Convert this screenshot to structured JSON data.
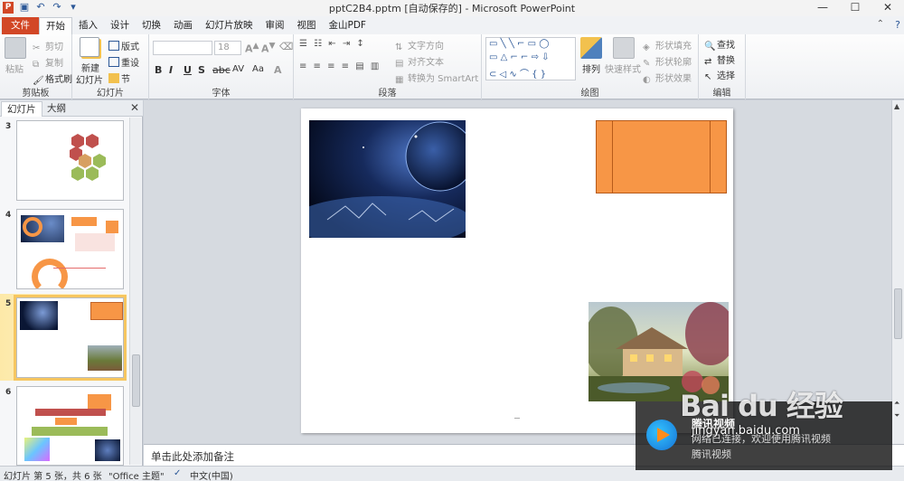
{
  "window": {
    "title": "pptC2B4.pptm [自动保存的] - Microsoft PowerPoint",
    "app_icon": "P",
    "minimize": "—",
    "maximize": "☐",
    "close": "✕"
  },
  "quick_access": [
    "save-icon",
    "undo-icon",
    "redo-icon",
    "customize-icon"
  ],
  "tabs": [
    {
      "label": "文件"
    },
    {
      "label": "开始"
    },
    {
      "label": "插入"
    },
    {
      "label": "设计"
    },
    {
      "label": "切换"
    },
    {
      "label": "动画"
    },
    {
      "label": "幻灯片放映"
    },
    {
      "label": "审阅"
    },
    {
      "label": "视图"
    },
    {
      "label": "金山PDF"
    }
  ],
  "ribbon": {
    "clipboard": {
      "paste": "粘贴",
      "cut": "剪切",
      "copy": "复制",
      "format_painter": "格式刷",
      "label": "剪贴板"
    },
    "slides": {
      "new_slide": "新建",
      "new_slide_2": "幻灯片",
      "layout": "版式",
      "reset": "重设",
      "section": "节",
      "label": "幻灯片"
    },
    "font": {
      "size": "18",
      "label": "字体"
    },
    "paragraph": {
      "text_direction": "文字方向",
      "align_text": "对齐文本",
      "convert_smartart": "转换为 SmartArt",
      "label": "段落"
    },
    "drawing": {
      "arrange": "排列",
      "quick_styles": "快速样式",
      "shape_fill": "形状填充",
      "shape_outline": "形状轮廓",
      "shape_effects": "形状效果",
      "label": "绘图"
    },
    "editing": {
      "find": "查找",
      "replace": "替换",
      "select": "选择",
      "label": "编辑"
    }
  },
  "panel": {
    "tab_slides": "幻灯片",
    "tab_outline": "大纲",
    "slides": [
      {
        "number": "3"
      },
      {
        "number": "4"
      },
      {
        "number": "5"
      },
      {
        "number": "6"
      }
    ]
  },
  "notes_placeholder": "单击此处添加备注",
  "status": {
    "slide_info": "幻灯片 第 5 张，共 6 张",
    "theme": "\"Office 主题\"",
    "language": "中文(中国)"
  },
  "watermark": {
    "title": "腾讯视频",
    "line1": "网络已连接，欢迎使用腾讯视频",
    "line2": "腾讯视频",
    "brand": "Bai du 经验",
    "url": "jingyan.baidu.com"
  },
  "colors": {
    "accent": "#d24726",
    "orange_shape": "#f79646",
    "selection": "#f6c660"
  }
}
